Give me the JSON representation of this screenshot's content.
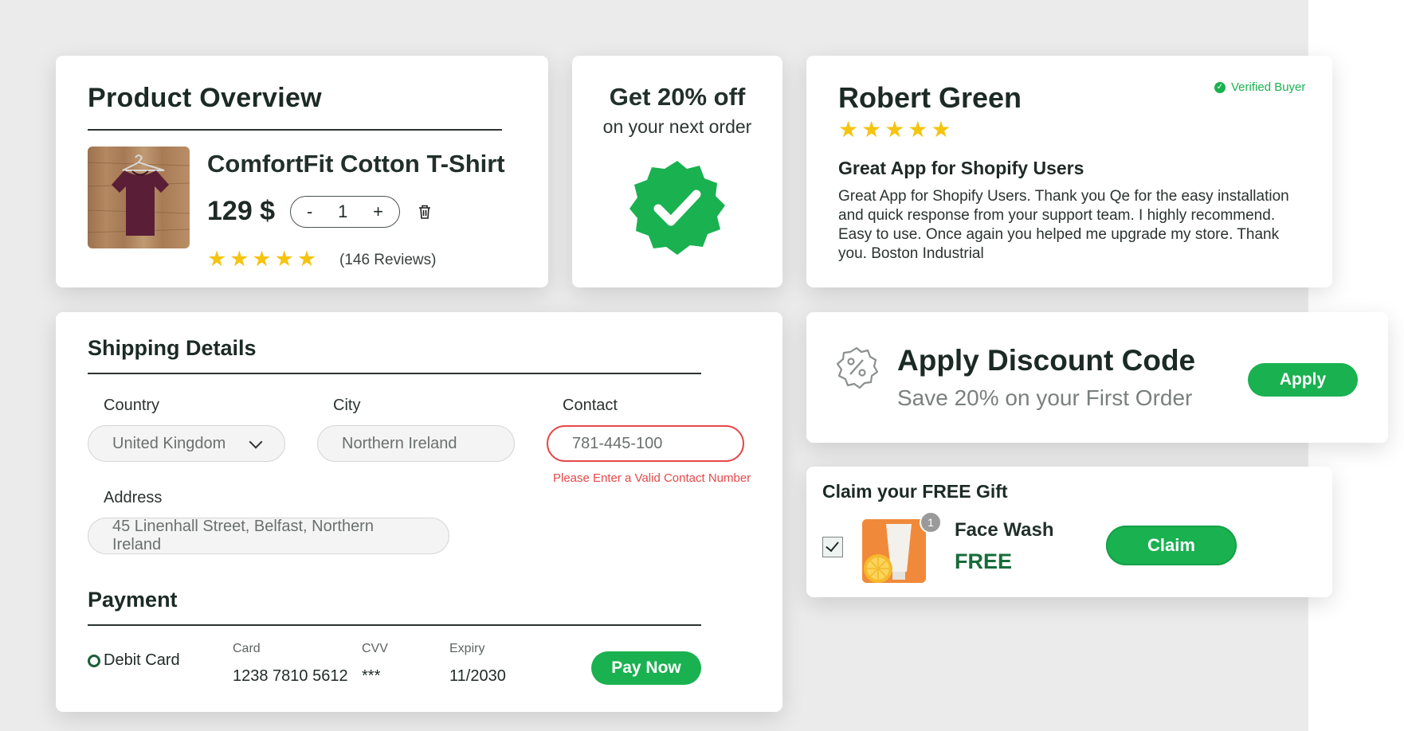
{
  "product": {
    "title": "Product Overview",
    "name": "ComfortFit Cotton T-Shirt",
    "price": "129 $",
    "qty_minus": "-",
    "qty_value": "1",
    "qty_plus": "+",
    "stars": "★★★★★",
    "rating": 5,
    "reviews": "(146 Reviews)"
  },
  "promo": {
    "title": "Get 20% off",
    "subtitle": "on your next order"
  },
  "review": {
    "name": "Robert Green",
    "verified": "Verified Buyer",
    "stars": "★★★★★",
    "rating": 5,
    "headline": "Great App for Shopify Users",
    "body": "Great App for Shopify Users. Thank you Qe for the easy installation and quick response from your support team. I highly recommend. Easy to use. Once again you helped me upgrade my store. Thank you. Boston Industrial"
  },
  "shipping": {
    "title": "Shipping Details",
    "country_label": "Country",
    "country_value": "United Kingdom",
    "city_label": "City",
    "city_value": "Northern Ireland",
    "contact_label": "Contact",
    "contact_value": "781-445-100",
    "contact_error": "Please Enter a Valid Contact Number",
    "address_label": "Address",
    "address_value": "45 Linenhall Street, Belfast, Northern Ireland"
  },
  "payment": {
    "title": "Payment",
    "method": "Debit Card",
    "card_label": "Card",
    "card_value": "1238 7810 5612",
    "cvv_label": "CVV",
    "cvv_value": "***",
    "expiry_label": "Expiry",
    "expiry_value": "11/2030",
    "pay_button": "Pay Now"
  },
  "discount": {
    "title": "Apply Discount Code",
    "subtitle": "Save 20% on your First Order",
    "apply_button": "Apply"
  },
  "gift": {
    "title": "Claim your FREE Gift",
    "badge": "1",
    "name": "Face Wash",
    "price": "FREE",
    "claim_button": "Claim"
  },
  "colors": {
    "accent": "#1ab150",
    "error": "#e6484a",
    "star": "#f4c40f"
  }
}
